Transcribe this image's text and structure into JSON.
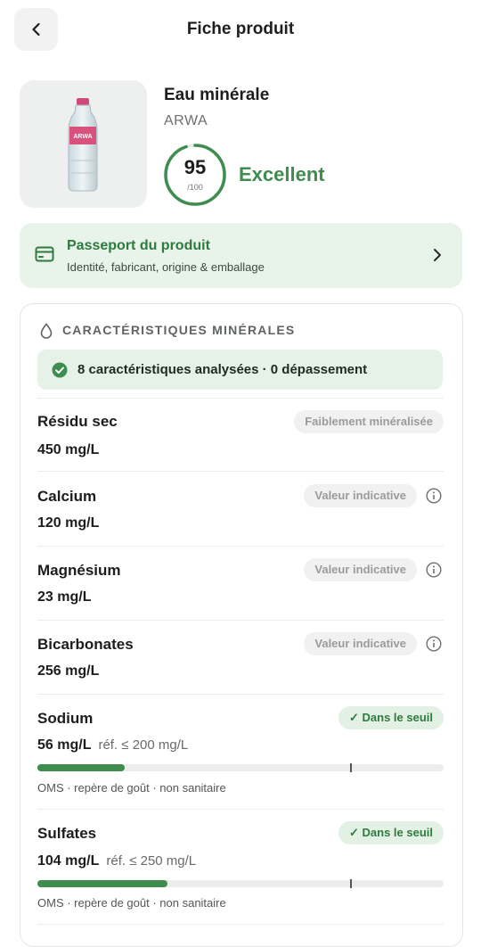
{
  "header": {
    "title": "Fiche produit"
  },
  "product": {
    "name": "Eau minérale",
    "brand": "ARWA",
    "image_icon": "water-bottle-image",
    "label_text": "ARWA"
  },
  "score": {
    "value": "95",
    "max": "/100",
    "label": "Excellent",
    "fraction": 0.95,
    "color": "#3f8d4e"
  },
  "passport": {
    "title": "Passeport du produit",
    "subtitle": "Identité, fabricant, origine & emballage",
    "icon": "card-icon"
  },
  "minerals": {
    "section_title": "CARACTÉRISTIQUES MINÉRALES",
    "summary": "8 caractéristiques analysées · 0 dépassement",
    "rows": [
      {
        "name": "Résidu sec",
        "value": "450 mg/L",
        "badge": "Faiblement minéralisée"
      },
      {
        "name": "Calcium",
        "value": "120 mg/L",
        "badge": "Valeur indicative"
      },
      {
        "name": "Magnésium",
        "value": "23 mg/L",
        "badge": "Valeur indicative"
      },
      {
        "name": "Bicarbonates",
        "value": "256 mg/L",
        "badge": "Valeur indicative"
      },
      {
        "name": "Sodium",
        "value": "56 mg/L",
        "ref": "réf. ≤ 200 mg/L",
        "badge": "✓ Dans le seuil",
        "level": 0.215,
        "note": "OMS · repère de goût · non sanitaire"
      },
      {
        "name": "Sulfates",
        "value": "104 mg/L",
        "ref": "réf. ≤ 250 mg/L",
        "badge": "✓ Dans le seuil",
        "level": 0.32,
        "note": "OMS · repère de goût · non sanitaire"
      }
    ]
  },
  "colors": {
    "accent": "#3f8d4e",
    "badge_grey": "#9a9c9a"
  }
}
